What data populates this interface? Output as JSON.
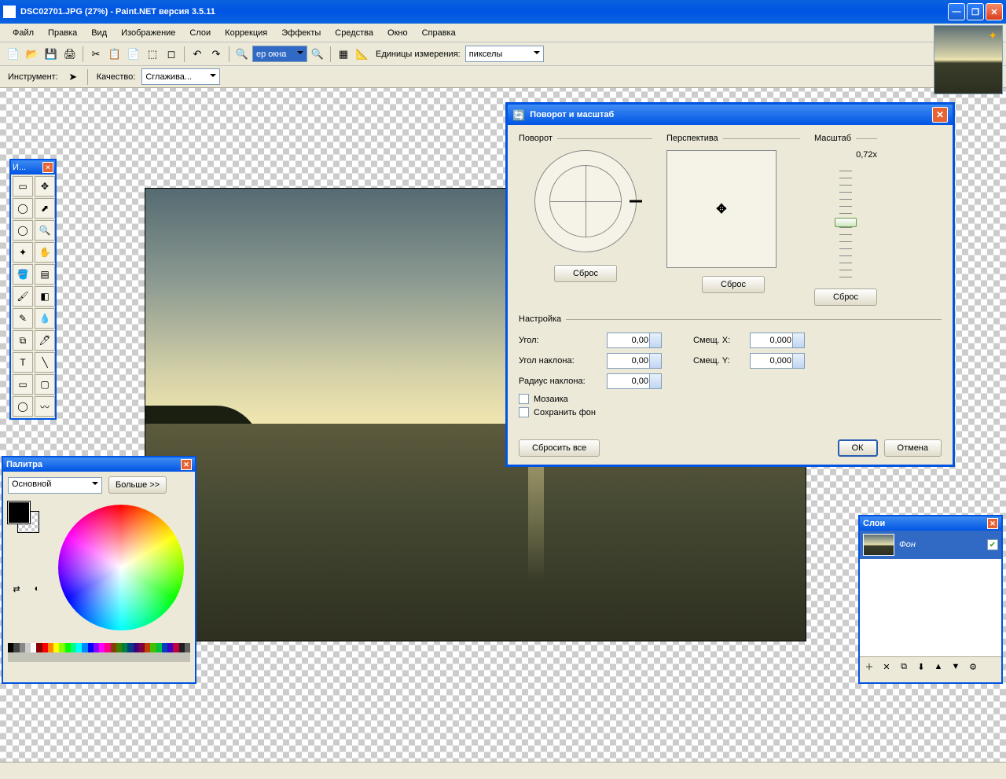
{
  "titlebar": {
    "title": "DSC02701.JPG (27%) - Paint.NET версия 3.5.11"
  },
  "menu": [
    "Файл",
    "Правка",
    "Вид",
    "Изображение",
    "Слои",
    "Коррекция",
    "Эффекты",
    "Средства",
    "Окно",
    "Справка"
  ],
  "toolbar": {
    "zoom_combo": "ер окна",
    "units_label": "Единицы измерения:",
    "units_value": "пикселы"
  },
  "toolbar2": {
    "tool_label": "Инструмент:",
    "quality_label": "Качество:",
    "quality_value": "Сглажива..."
  },
  "tools_win": {
    "title": "И..."
  },
  "colors_win": {
    "title": "Палитра",
    "mode": "Основной",
    "more": "Больше >>"
  },
  "layers_win": {
    "title": "Слои",
    "layer_name": "Фон"
  },
  "dialog": {
    "title": "Поворот и масштаб",
    "rotation_label": "Поворот",
    "perspective_label": "Перспектива",
    "scale_label": "Масштаб",
    "scale_value": "0,72x",
    "reset": "Сброс",
    "tuning_label": "Настройка",
    "angle_label": "Угол:",
    "angle_value": "0,00",
    "tilt_angle_label": "Угол наклона:",
    "tilt_angle_value": "0,00",
    "tilt_radius_label": "Радиус наклона:",
    "tilt_radius_value": "0,00",
    "offset_x_label": "Смещ. X:",
    "offset_x_value": "0,000",
    "offset_y_label": "Смещ. Y:",
    "offset_y_value": "0,000",
    "mosaic": "Мозаика",
    "keep_bg": "Сохранить фон",
    "reset_all": "Сбросить все",
    "ok": "ОК",
    "cancel": "Отмена"
  },
  "palette_hues": [
    "#000",
    "#444",
    "#888",
    "#ccc",
    "#fff",
    "#800",
    "#f00",
    "#f80",
    "#ff0",
    "#8f0",
    "#0f0",
    "#0f8",
    "#0ff",
    "#08f",
    "#00f",
    "#80f",
    "#f0f",
    "#f08",
    "#804000",
    "#408000",
    "#008040",
    "#004080",
    "#400080",
    "#800040",
    "#c04000",
    "#40c000",
    "#00c040",
    "#0040c0",
    "#4000c0",
    "#c00040",
    "#202020",
    "#606060"
  ]
}
